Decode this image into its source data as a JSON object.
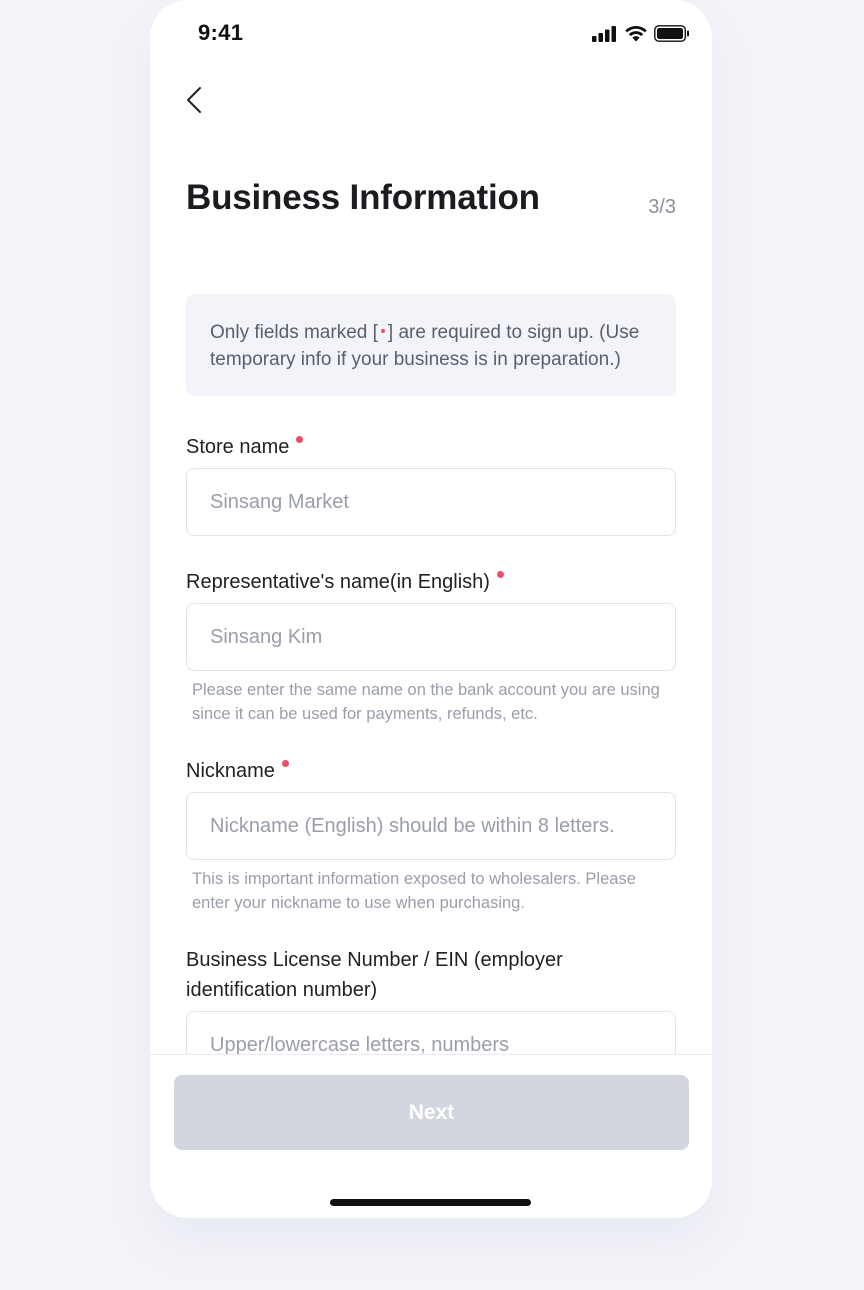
{
  "status_bar": {
    "time": "9:41",
    "icons": [
      "signal-icon",
      "wifi-icon",
      "battery-icon"
    ]
  },
  "header": {
    "back_icon": "chevron-left-icon",
    "title": "Business Information",
    "step": "3/3"
  },
  "notice": {
    "text_before": "Only fields marked [",
    "text_after": "] are required to sign up. (Use temporary info if your business is in preparation.)"
  },
  "form": {
    "store_name": {
      "label": "Store name",
      "required": true,
      "placeholder": "Sinsang Market"
    },
    "representative_name": {
      "label": "Representative's name(in English)",
      "required": true,
      "placeholder": "Sinsang Kim",
      "hint": "Please enter the same name on the bank account you are using since it can be used for payments, refunds, etc."
    },
    "nickname": {
      "label": "Nickname",
      "required": true,
      "placeholder": "Nickname (English) should be within 8 letters.",
      "hint": "This is important information exposed to wholesalers. Please enter your nickname to use when purchasing."
    },
    "business_license": {
      "label": "Business License Number / EIN (employer identification number)",
      "required": false,
      "placeholder": "Upper/lowercase letters, numbers"
    }
  },
  "footer": {
    "next_label": "Next"
  },
  "colors": {
    "background": "#f3f4f9",
    "required_dot": "#ef4b66",
    "button_disabled": "#d3d6df",
    "placeholder": "#9a9eab"
  }
}
